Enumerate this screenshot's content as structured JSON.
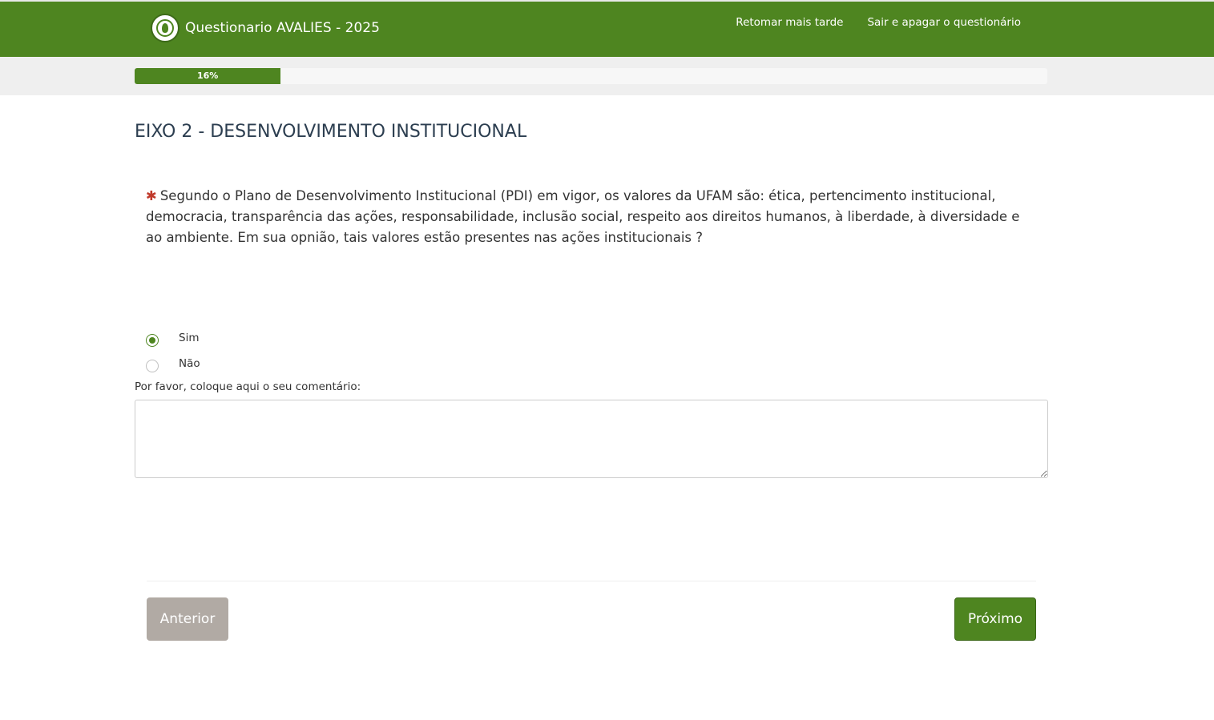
{
  "header": {
    "title": "Questionario AVALIES - 2025",
    "links": [
      {
        "label": "Retomar mais tarde"
      },
      {
        "label": "Sair e apagar o questionário"
      }
    ]
  },
  "progress": {
    "percent": 16,
    "label": "16%"
  },
  "section": {
    "title": "EIXO 2 - DESENVOLVIMENTO INSTITUCIONAL"
  },
  "question": {
    "required_mark": "✱",
    "text": "Segundo o Plano de Desenvolvimento Institucional (PDI) em vigor, os valores da UFAM são: ética, pertencimento institucional, democracia, transparência das ações, responsabilidade, inclusão social, respeito aos direitos humanos, à liberdade, à diversidade e ao ambiente. Em sua opnião, tais valores estão presentes nas ações institucionais ?",
    "options": [
      {
        "label": "Sim",
        "selected": true
      },
      {
        "label": "Não",
        "selected": false
      }
    ]
  },
  "comment": {
    "label": "Por favor, coloque aqui o seu comentário:",
    "value": ""
  },
  "footer": {
    "prev_label": "Anterior",
    "next_label": "Próximo"
  },
  "colors": {
    "brand": "#4e8520",
    "prev_button": "#b1aaa4",
    "required": "#c0392b"
  }
}
